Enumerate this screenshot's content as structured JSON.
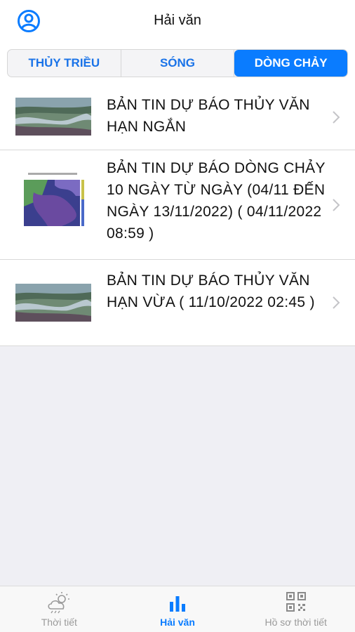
{
  "header": {
    "title": "Hải văn",
    "profile_icon": "user-circle-icon"
  },
  "tabs": [
    {
      "label": "THỦY TRIỀU",
      "active": false
    },
    {
      "label": "SÓNG",
      "active": false
    },
    {
      "label": "DÒNG CHẢY",
      "active": true
    }
  ],
  "items": [
    {
      "title": "BẢN TIN DỰ BÁO THỦY VĂN HẠN NGẮN",
      "thumb": "river-aerial-photo"
    },
    {
      "title": "BẢN TIN DỰ BÁO DÒNG CHẢY 10 NGÀY TỪ NGÀY (04/11 ĐẾN NGÀY 13/11/2022) ( 04/11/2022 08:59 )",
      "thumb": "current-map-chart"
    },
    {
      "title": "BẢN TIN DỰ BÁO THỦY VĂN HẠN VỪA ( 11/10/2022 02:45 )",
      "thumb": "river-aerial-photo"
    }
  ],
  "bottom_nav": [
    {
      "label": "Thời tiết",
      "icon": "weather-cloud-sun-icon",
      "active": false
    },
    {
      "label": "Hải văn",
      "icon": "bar-chart-icon",
      "active": true
    },
    {
      "label": "Hồ sơ thời tiết",
      "icon": "qr-code-icon",
      "active": false
    }
  ],
  "colors": {
    "accent": "#0a7cff",
    "tab_text": "#1a73e8",
    "background": "#efeff4"
  }
}
